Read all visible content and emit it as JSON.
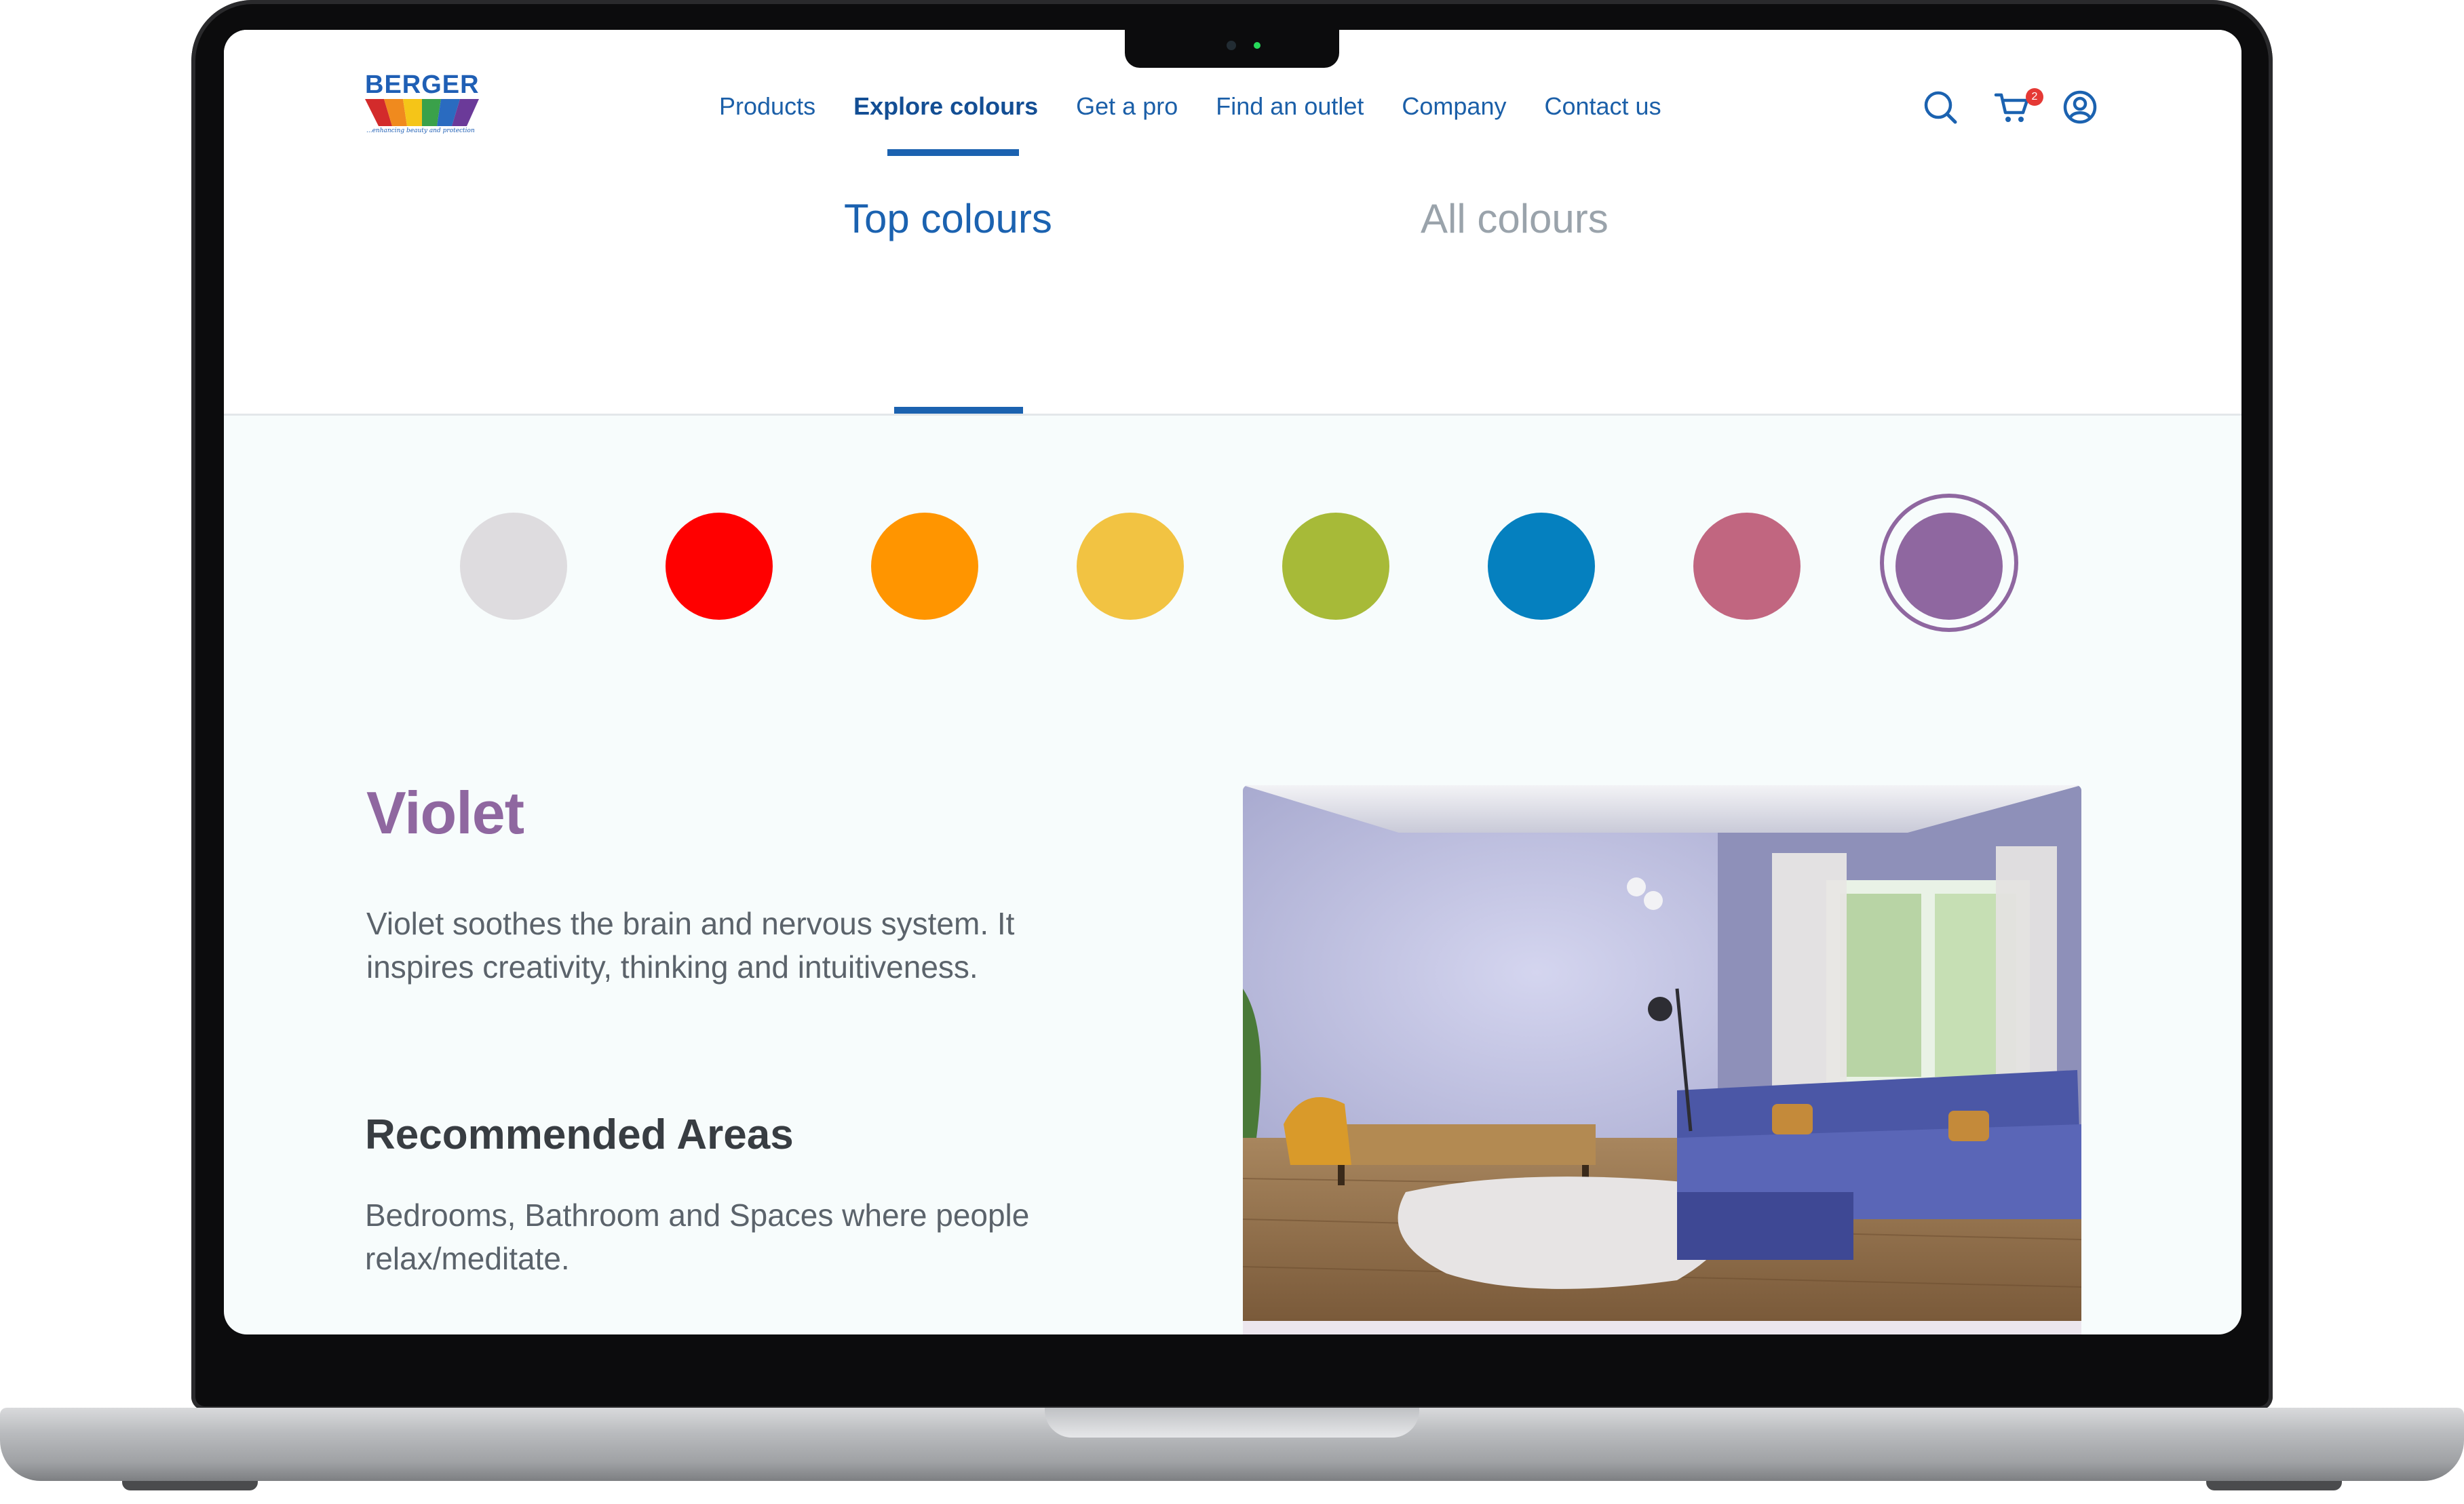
{
  "header": {
    "logo": {
      "brand": "BERGER",
      "tagline": "...enhancing beauty and protection"
    },
    "nav": [
      {
        "label": "Products",
        "active": false
      },
      {
        "label": "Explore colours",
        "active": true
      },
      {
        "label": "Get a pro",
        "active": false
      },
      {
        "label": "Find an outlet",
        "active": false
      },
      {
        "label": "Company",
        "active": false
      },
      {
        "label": "Contact us",
        "active": false
      }
    ],
    "icons": {
      "search": "search-icon",
      "cart": "cart-icon",
      "account": "user-circle-icon"
    },
    "cart_count": "2"
  },
  "tabs": [
    {
      "label": "Top colours",
      "active": true
    },
    {
      "label": "All colours",
      "active": false
    }
  ],
  "swatches": [
    {
      "name": "white",
      "color": "#dedcdf"
    },
    {
      "name": "red",
      "color": "#ff0000"
    },
    {
      "name": "orange",
      "color": "#ff9500"
    },
    {
      "name": "yellow",
      "color": "#f2c342"
    },
    {
      "name": "green",
      "color": "#a7ba38"
    },
    {
      "name": "blue",
      "color": "#0580bf"
    },
    {
      "name": "pink",
      "color": "#c16680"
    },
    {
      "name": "violet",
      "color": "#8f67a0",
      "selected": true
    }
  ],
  "selected_colour": {
    "name": "Violet",
    "description": "Violet soothes the brain and nervous system. It inspires creativity, thinking and intuitiveness.",
    "recommended_title": "Recommended Areas",
    "recommended_body": "Bedrooms, Bathroom and Spaces where people relax/meditate."
  },
  "colors": {
    "brand_blue": "#1b62b0",
    "accent_violet": "#8f67a0"
  }
}
